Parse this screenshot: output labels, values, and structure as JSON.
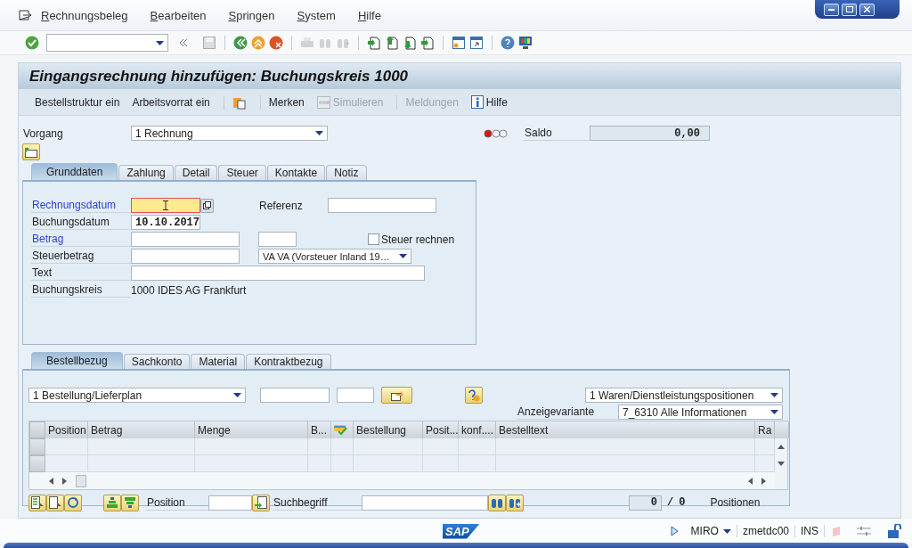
{
  "menu": [
    {
      "label": "Rechnungsbeleg"
    },
    {
      "label": "Bearbeiten"
    },
    {
      "label": "Springen"
    },
    {
      "label": "System"
    },
    {
      "label": "Hilfe"
    }
  ],
  "title": "Eingangsrechnung hinzufügen: Buchungskreis 1000",
  "app_toolbar": [
    {
      "kind": "text",
      "label": "Bestellstruktur ein",
      "disabled": false
    },
    {
      "kind": "text",
      "label": "Arbeitsvorrat ein",
      "disabled": false
    },
    {
      "kind": "separator"
    },
    {
      "kind": "clipboard",
      "disabled": false
    },
    {
      "kind": "separator"
    },
    {
      "kind": "text",
      "label": "Merken",
      "disabled": false
    },
    {
      "kind": "simulate",
      "label": "Simulieren",
      "disabled": true
    },
    {
      "kind": "separator"
    },
    {
      "kind": "text",
      "label": "Meldungen",
      "disabled": true
    },
    {
      "kind": "info",
      "label": "Hilfe",
      "disabled": false
    }
  ],
  "header": {
    "vorgang_label": "Vorgang",
    "vorgang_value": "1 Rechnung",
    "saldo_label": "Saldo",
    "saldo_value": "0,00"
  },
  "tabs": [
    {
      "label": "Grunddaten",
      "selected": true
    },
    {
      "label": "Zahlung",
      "selected": false
    },
    {
      "label": "Detail",
      "selected": false
    },
    {
      "label": "Steuer",
      "selected": false
    },
    {
      "label": "Kontakte",
      "selected": false
    },
    {
      "label": "Notiz",
      "selected": false
    }
  ],
  "fields": [
    {
      "kind": "date",
      "label": "Rechnungsdatum",
      "required": true,
      "focused": true,
      "side_label": "Referenz"
    },
    {
      "kind": "value",
      "label": "Buchungsdatum",
      "required": false,
      "value": "10.10.2017"
    },
    {
      "kind": "amount",
      "label": "Betrag",
      "required": true,
      "checkbox": {
        "label": "Steuer rechnen",
        "checked": false
      }
    },
    {
      "kind": "tax",
      "label": "Steuerbetrag",
      "required": false,
      "value": "VA VA (Vorsteuer Inland 19…"
    },
    {
      "kind": "text",
      "label": "Text",
      "required": false
    },
    {
      "kind": "display",
      "label": "Buchungskreis",
      "required": false,
      "value": "1000 IDES AG Frankfurt"
    }
  ],
  "item_tabs": [
    {
      "label": "Bestellbezug",
      "selected": true
    },
    {
      "label": "Sachkonto",
      "selected": false
    },
    {
      "label": "Material",
      "selected": false
    },
    {
      "label": "Kontraktbezug",
      "selected": false
    }
  ],
  "reference": {
    "type_value": "1 Bestellung/Lieferplan",
    "layout_value": "1 Waren/Dienstleistungspositionen",
    "variant_label": "Anzeigevariante",
    "variant_value": "7_6310 Alle Informationen"
  },
  "table": {
    "columns": [
      {
        "kind": "text",
        "label": "Position"
      },
      {
        "kind": "text",
        "label": "Betrag"
      },
      {
        "kind": "text",
        "label": "Menge"
      },
      {
        "kind": "text",
        "label": "B..."
      },
      {
        "kind": "icon"
      },
      {
        "kind": "text",
        "label": "Bestellung"
      },
      {
        "kind": "text",
        "label": "Posit..."
      },
      {
        "kind": "text",
        "label": "konf...."
      },
      {
        "kind": "text",
        "label": "Bestelltext"
      },
      {
        "kind": "text",
        "label": "Ra"
      }
    ]
  },
  "footer": {
    "position_label": "Position",
    "search_label": "Suchbegriff",
    "count": "0",
    "separator": "/",
    "total": "0",
    "count_label": "Positionen"
  },
  "status_bar": {
    "logo": "SAP",
    "transaction": "MIRO",
    "server": "zmetdc00",
    "mode": "INS"
  }
}
